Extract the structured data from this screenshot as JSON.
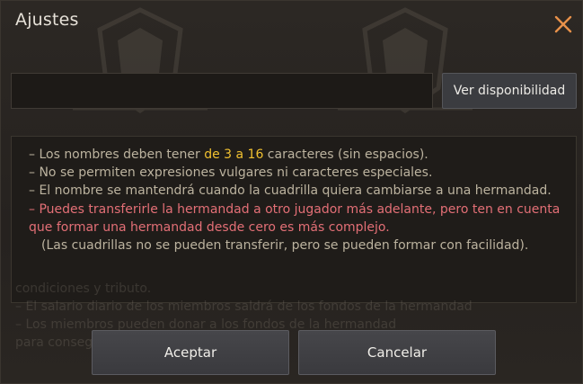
{
  "dialog": {
    "title": "Ajustes"
  },
  "name_field": {
    "value": "",
    "placeholder": ""
  },
  "check_button_label": "Ver disponibilidad",
  "rules": {
    "line1_prefix": "– Los nombres deben tener ",
    "line1_highlight": "de 3 a 16",
    "line1_suffix": " caracteres (sin espacios).",
    "line2": "– No se permiten expresiones vulgares ni caracteres especiales.",
    "line3": "– El nombre se mantendrá cuando la cuadrilla quiera cambiarse a una hermandad.",
    "line4": "– Puedes transferirle la hermandad a otro jugador más adelante, pero ten en cuenta que formar una hermandad desde cero es más complejo.",
    "line5": "(Las cuadrillas no se pueden transferir, pero se pueden formar con facilidad)."
  },
  "background_text": {
    "mid": "dad",
    "line1": "condiciones y tributo.",
    "line2": "– El salario diario de los miembros saldrá de los fondos de la hermandad",
    "line3": "– Los miembros pueden donar a los fondos de la hermandad",
    "line4": "para conseguir..."
  },
  "footer": {
    "accept_label": "Aceptar",
    "cancel_label": "Cancelar"
  },
  "colors": {
    "highlight": "#f0c030",
    "warning": "#e36f76",
    "body_text": "#bcb39f",
    "close_icon": "#e8914a"
  }
}
